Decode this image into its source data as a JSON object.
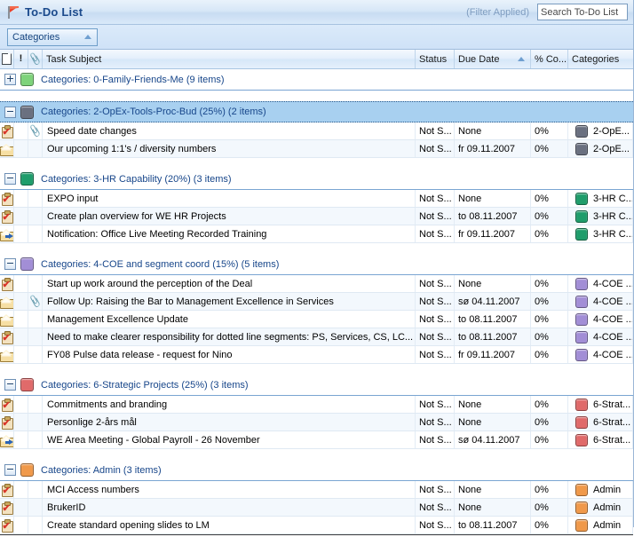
{
  "window": {
    "title": "To-Do List",
    "flag_icon": "red-flag-icon",
    "filter_status": "(Filter Applied)"
  },
  "search": {
    "placeholder": "Search To-Do List",
    "value": ""
  },
  "arrange": {
    "sort_button_label": "Categories",
    "sort_direction_icon": "ascending-arrow-icon"
  },
  "columns": {
    "icon_headers": [
      {
        "name": "importance-icon",
        "glyph": "!"
      },
      {
        "name": "attachment-icon",
        "glyph": "0"
      }
    ],
    "task_subject": "Task Subject",
    "status": "Status",
    "due_date": "Due Date",
    "percent_complete": "% Co...",
    "categories": "Categories",
    "sorted_by": "Due Date",
    "sort_indicator": "ascending"
  },
  "groups": [
    {
      "label": "Categories: 0-Family-Friends-Me (9 items)",
      "color": "#7ed37a",
      "expanded": false,
      "selected": false,
      "items": []
    },
    {
      "label": "Categories: 2-OpEx-Tools-Proc-Bud (25%) (2 items)",
      "color": "#6a7080",
      "expanded": true,
      "selected": true,
      "items": [
        {
          "icon": "task-icon",
          "attachment": true,
          "subject": "Speed date changes",
          "status": "Not S...",
          "due_date": "None",
          "percent": "0%",
          "category": "2-OpE...",
          "category_color": "#6a7080"
        },
        {
          "icon": "mail-icon",
          "attachment": false,
          "subject": "Our upcoming 1:1's / diversity numbers",
          "status": "Not S...",
          "due_date": "fr 09.11.2007",
          "percent": "0%",
          "category": "2-OpE...",
          "category_color": "#6a7080"
        }
      ]
    },
    {
      "label": "Categories: 3-HR Capability (20%) (3 items)",
      "color": "#1f9d6b",
      "expanded": true,
      "selected": false,
      "items": [
        {
          "icon": "task-icon",
          "attachment": false,
          "subject": "EXPO input",
          "status": "Not S...",
          "due_date": "None",
          "percent": "0%",
          "category": "3-HR C...",
          "category_color": "#1f9d6b"
        },
        {
          "icon": "task-icon",
          "attachment": false,
          "subject": "Create plan overview for WE HR Projects",
          "status": "Not S...",
          "due_date": "to 08.11.2007",
          "percent": "0%",
          "category": "3-HR C...",
          "category_color": "#1f9d6b"
        },
        {
          "icon": "mail-forwarded-icon",
          "attachment": false,
          "subject": "Notification:  Office Live Meeting Recorded Training",
          "status": "Not S...",
          "due_date": "fr 09.11.2007",
          "percent": "0%",
          "category": "3-HR C...",
          "category_color": "#1f9d6b"
        }
      ]
    },
    {
      "label": "Categories: 4-COE and segment coord (15%) (5 items)",
      "color": "#a28ed6",
      "expanded": true,
      "selected": false,
      "items": [
        {
          "icon": "task-icon",
          "attachment": false,
          "subject": "Start up work around the perception of the Deal",
          "status": "Not S...",
          "due_date": "None",
          "percent": "0%",
          "category": "4-COE ...",
          "category_color": "#a28ed6"
        },
        {
          "icon": "mail-icon",
          "attachment": true,
          "subject": "Follow Up: Raising the Bar to Management Excellence in Services",
          "status": "Not S...",
          "due_date": "sø 04.11.2007",
          "percent": "0%",
          "category": "4-COE ...",
          "category_color": "#a28ed6"
        },
        {
          "icon": "mail-icon",
          "attachment": false,
          "subject": "Management Excellence Update",
          "status": "Not S...",
          "due_date": "to 08.11.2007",
          "percent": "0%",
          "category": "4-COE ...",
          "category_color": "#a28ed6"
        },
        {
          "icon": "task-icon",
          "attachment": false,
          "subject": "Need to make clearer responsibility for dotted line segments: PS, Services, CS, LC...",
          "status": "Not S...",
          "due_date": "to 08.11.2007",
          "percent": "0%",
          "category": "4-COE ...",
          "category_color": "#a28ed6"
        },
        {
          "icon": "mail-icon",
          "attachment": false,
          "subject": "FY08 Pulse data release - request for Nino",
          "status": "Not S...",
          "due_date": "fr 09.11.2007",
          "percent": "0%",
          "category": "4-COE ...",
          "category_color": "#a28ed6"
        }
      ]
    },
    {
      "label": "Categories: 6-Strategic Projects (25%) (3 items)",
      "color": "#e06a6a",
      "expanded": true,
      "selected": false,
      "items": [
        {
          "icon": "task-icon",
          "attachment": false,
          "subject": "Commitments and branding",
          "status": "Not S...",
          "due_date": "None",
          "percent": "0%",
          "category": "6-Strat...",
          "category_color": "#e06a6a"
        },
        {
          "icon": "task-icon",
          "attachment": false,
          "subject": "Personlige 2-års mål",
          "status": "Not S...",
          "due_date": "None",
          "percent": "0%",
          "category": "6-Strat...",
          "category_color": "#e06a6a"
        },
        {
          "icon": "mail-forwarded-icon",
          "attachment": false,
          "subject": "WE Area Meeting - Global Payroll - 26 November",
          "status": "Not S...",
          "due_date": "sø 04.11.2007",
          "percent": "0%",
          "category": "6-Strat...",
          "category_color": "#e06a6a"
        }
      ]
    },
    {
      "label": "Categories: Admin (3 items)",
      "color": "#f0994a",
      "expanded": true,
      "selected": false,
      "items": [
        {
          "icon": "task-icon",
          "attachment": false,
          "subject": "MCI Access numbers",
          "status": "Not S...",
          "due_date": "None",
          "percent": "0%",
          "category": "Admin",
          "category_color": "#f0994a"
        },
        {
          "icon": "task-icon",
          "attachment": false,
          "subject": "BrukerID",
          "status": "Not S...",
          "due_date": "None",
          "percent": "0%",
          "category": "Admin",
          "category_color": "#f0994a"
        },
        {
          "icon": "task-icon",
          "attachment": false,
          "subject": "Create standard opening slides to LM",
          "status": "Not S...",
          "due_date": "to 08.11.2007",
          "percent": "0%",
          "category": "Admin",
          "category_color": "#f0994a"
        }
      ]
    }
  ],
  "layout": {
    "col_w_doc": 16,
    "col_w_bang": 16,
    "col_w_clip": 16,
    "col_w_subject": 420,
    "col_w_status": 44,
    "col_w_due": 86,
    "col_w_pct": 42,
    "col_w_cat": 73
  }
}
